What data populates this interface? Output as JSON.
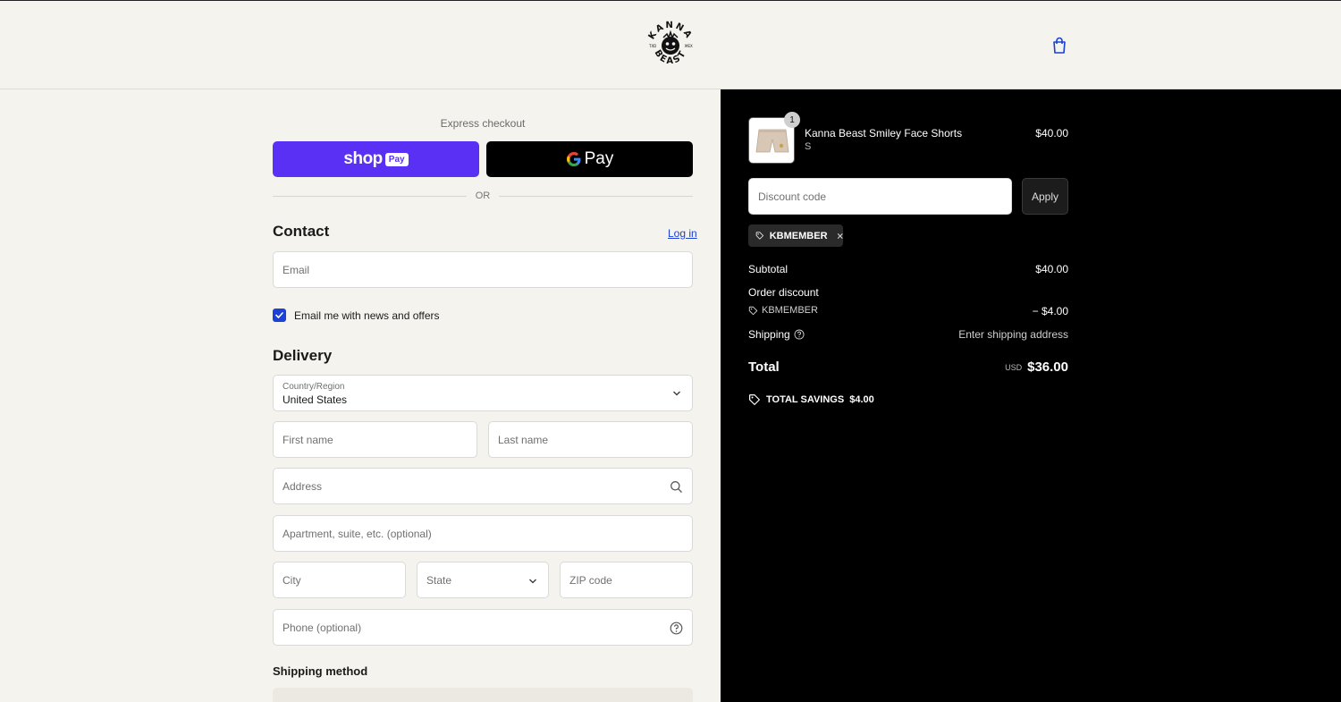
{
  "header": {
    "logo_text": "KANNA BEAST",
    "logo_side_left": "TXD",
    "logo_side_right": "MEX",
    "cart_icon": "shopping-bag-icon",
    "accent_color": "#1b41d6"
  },
  "express": {
    "label": "Express checkout",
    "shoppay_label": "shop",
    "shoppay_badge": "Pay",
    "gpay_label": "Pay",
    "divider": "OR"
  },
  "contact": {
    "title": "Contact",
    "login": "Log in",
    "email_placeholder": "Email",
    "newsletter_label": "Email me with news and offers",
    "newsletter_checked": true
  },
  "delivery": {
    "title": "Delivery",
    "country_label": "Country/Region",
    "country_value": "United States",
    "first_name": "First name",
    "last_name": "Last name",
    "address": "Address",
    "apartment": "Apartment, suite, etc. (optional)",
    "city": "City",
    "state": "State",
    "zip": "ZIP code",
    "phone": "Phone (optional)"
  },
  "shipping_method": {
    "title": "Shipping method"
  },
  "summary": {
    "product": {
      "name": "Kanna Beast Smiley Face Shorts",
      "variant": "S",
      "price": "$40.00",
      "quantity": "1"
    },
    "discount_placeholder": "Discount code",
    "apply_label": "Apply",
    "applied_code": "KBMEMBER",
    "subtotal_label": "Subtotal",
    "subtotal_value": "$40.00",
    "order_discount_label": "Order discount",
    "discount_code": "KBMEMBER",
    "discount_value": "− $4.00",
    "shipping_label": "Shipping",
    "shipping_value": "Enter shipping address",
    "total_label": "Total",
    "currency": "USD",
    "total_value": "$36.00",
    "savings_label": "TOTAL SAVINGS",
    "savings_value": "$4.00"
  }
}
